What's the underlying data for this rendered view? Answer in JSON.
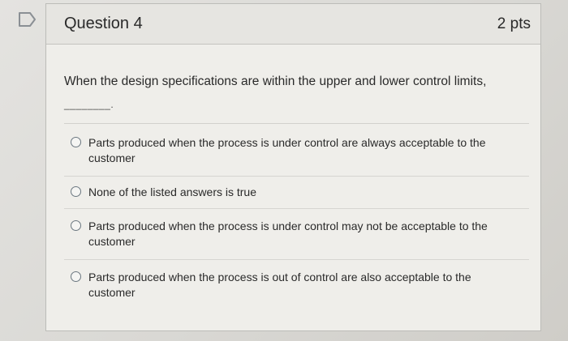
{
  "question": {
    "title": "Question 4",
    "points": "2 pts",
    "prompt": "When the design specifications are within the upper and lower control limits,",
    "blank": "________."
  },
  "answers": [
    {
      "label": "Parts produced when the process is under control are always acceptable to the customer",
      "selected": false
    },
    {
      "label": "None of the listed answers is true",
      "selected": false
    },
    {
      "label": "Parts produced when the process is under control may not be acceptable to the customer",
      "selected": false
    },
    {
      "label": "Parts produced when the process is out of control are also acceptable to the customer",
      "selected": false
    }
  ],
  "icons": {
    "flag": "bookmark-flag-icon",
    "radio": "radio-unselected-icon"
  },
  "colors": {
    "flag_stroke": "#8a8f94",
    "radio_border": "#6b7780",
    "text": "#2a2a2a"
  }
}
